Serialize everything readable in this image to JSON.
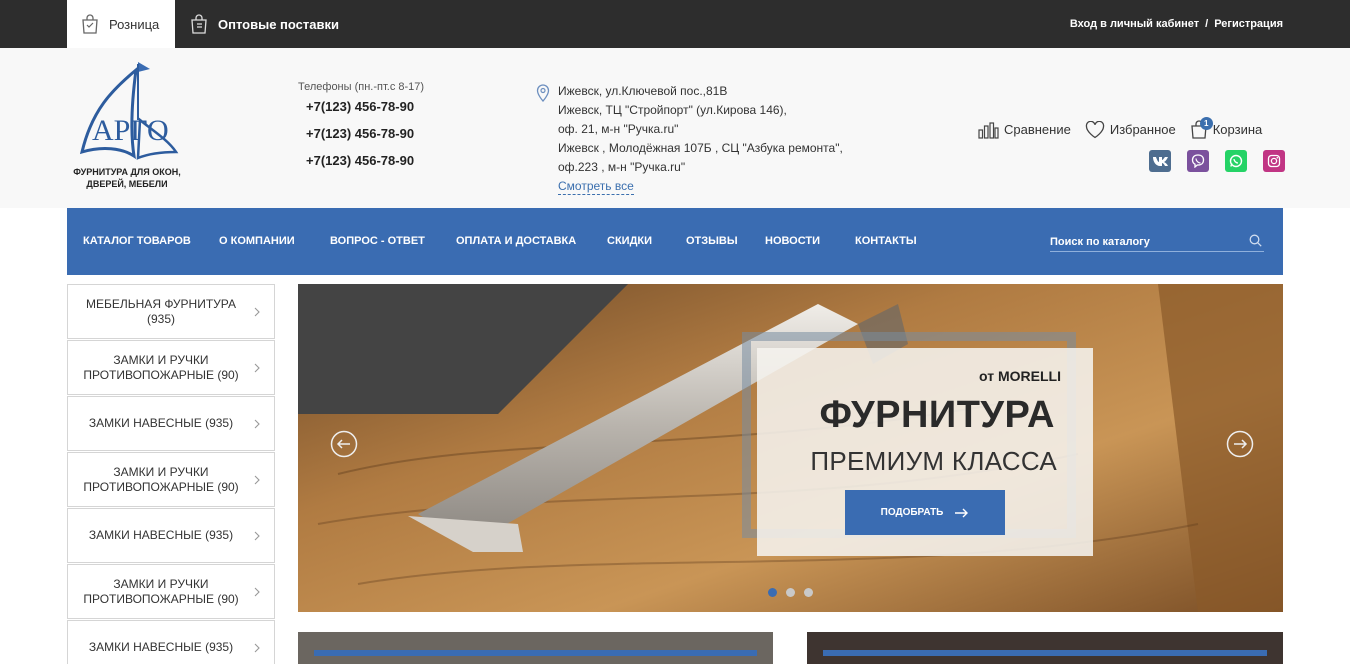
{
  "topbar": {
    "retail_label": "Розница",
    "wholesale_label": "Оптовые поставки",
    "login_label": "Вход в личный кабинет",
    "separator": "/",
    "register_label": "Регистрация"
  },
  "logo": {
    "name": "АРГО",
    "tagline_1": "ФУРНИТУРА ДЛЯ ОКОН,",
    "tagline_2": "ДВЕРЕЙ, МЕБЕЛИ"
  },
  "phones": {
    "label": "Телефоны (пн.-пт.с 8-17)",
    "numbers": [
      "+7(123) 456-78-90",
      "+7(123) 456-78-90",
      "+7(123) 456-78-90"
    ]
  },
  "address": {
    "lines": [
      "Ижевск, ул.Ключевой пос.,81В",
      "Ижевск, ТЦ \"Стройпорт\" (ул.Кирова 146),",
      "оф. 21, м-н \"Ручка.ru\"",
      "Ижевск , Молодёжная 107Б , СЦ \"Азбука ремонта\",",
      "оф.223 , м-н \"Ручка.ru\""
    ],
    "more_label": "Смотреть все"
  },
  "utils": {
    "compare_label": "Сравнение",
    "favorites_label": "Избранное",
    "cart_label": "Корзина",
    "cart_count": "1"
  },
  "socials": [
    "vk-icon",
    "viber-icon",
    "whatsapp-icon",
    "instagram-icon"
  ],
  "nav": {
    "items": [
      "КАТАЛОГ ТОВАРОВ",
      "О КОМПАНИИ",
      "ВОПРОС - ОТВЕТ",
      "ОПЛАТА И ДОСТАВКА",
      "СКИДКИ",
      "ОТЗЫВЫ",
      "НОВОСТИ",
      "КОНТАКТЫ"
    ],
    "search_placeholder": "Поиск по каталогу"
  },
  "sidebar": {
    "categories": [
      "МЕБЕЛЬНАЯ ФУРНИТУРА (935)",
      "ЗАМКИ И РУЧКИ ПРОТИВОПОЖАРНЫЕ (90)",
      "ЗАМКИ НАВЕСНЫЕ (935)",
      "ЗАМКИ И РУЧКИ ПРОТИВОПОЖАРНЫЕ (90)",
      "ЗАМКИ НАВЕСНЫЕ (935)",
      "ЗАМКИ И РУЧКИ ПРОТИВОПОЖАРНЫЕ (90)",
      "ЗАМКИ НАВЕСНЫЕ (935)"
    ]
  },
  "banner": {
    "from": "от MORELLI",
    "title": "ФУРНИТУРА",
    "subtitle": "ПРЕМИУМ КЛАССА",
    "button_label": "ПОДОБРАТЬ",
    "slide_count": 3,
    "active_slide": 1
  },
  "colors": {
    "topbar": "#2d2d2d",
    "accent": "#3a6cb2",
    "header_bg": "#f8f8f8"
  }
}
